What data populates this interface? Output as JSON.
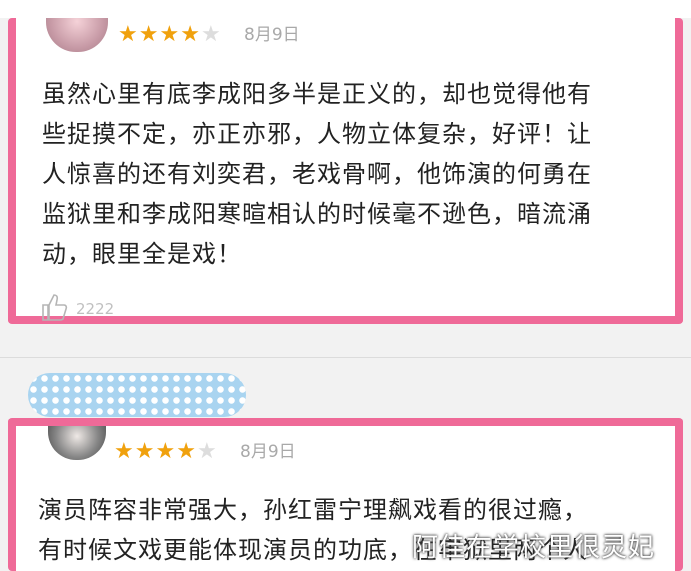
{
  "review1": {
    "rating": 4,
    "rating_max": 5,
    "date": "8月9日",
    "lines": [
      "虽然心里有底李成阳多半是正义的，却也觉得他有",
      "些捉摸不定，亦正亦邪，人物立体复杂，好评！让",
      "人惊喜的还有刘奕君，老戏骨啊，他饰演的何勇在",
      "监狱里和李成阳寒暄相认的时候毫不逊色，暗流涌",
      "动，眼里全是戏！"
    ],
    "like_icon": "thumbs-up-icon",
    "like_count": "2222"
  },
  "review2": {
    "rating": 4,
    "rating_max": 5,
    "date": "8月9日",
    "lines": [
      "演员阵容非常强大，孙红雷宁理飙戏看的很过瘾，",
      "有时候文戏更能体现演员的功底，在牢狱里两个人"
    ]
  },
  "watermark": "阿佳在学校里很灵妃",
  "colors": {
    "highlight_border": "#ef6a98",
    "star_filled": "#f0a10d",
    "star_empty": "#dddddd",
    "date_text": "#a9a9a9",
    "username_blur": "#a9d4f0"
  }
}
